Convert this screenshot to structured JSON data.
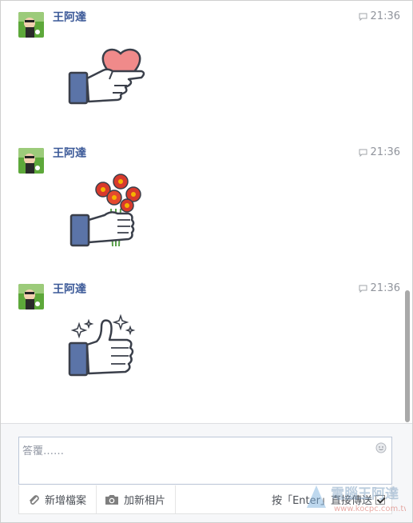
{
  "messages": [
    {
      "sender": "王阿達",
      "time": "21:36",
      "sticker": "hand-holding-heart-sticker",
      "avatar": "avatar-image"
    },
    {
      "sender": "王阿達",
      "time": "21:36",
      "sticker": "hand-holding-flowers-sticker",
      "avatar": "avatar-image"
    },
    {
      "sender": "王阿達",
      "time": "21:36",
      "sticker": "sparkling-thumbs-up-sticker",
      "avatar": "avatar-image"
    }
  ],
  "composer": {
    "placeholder": "答覆……",
    "add_file_label": "新增檔案",
    "add_photo_label": "加新相片",
    "enter_to_send_label": "按「Enter」直接傳送",
    "enter_to_send_checked": true
  },
  "colors": {
    "name_blue": "#3b5998",
    "cuff_blue": "#5b74a8",
    "timestamp_gray": "#90949c"
  },
  "icons": [
    "chat-bubble-icon",
    "emoji-smiley-icon",
    "paperclip-icon",
    "camera-icon",
    "checkbox-icon"
  ],
  "watermark": {
    "text": "電腦王阿達",
    "url": "www.kocpc.com.tw"
  }
}
